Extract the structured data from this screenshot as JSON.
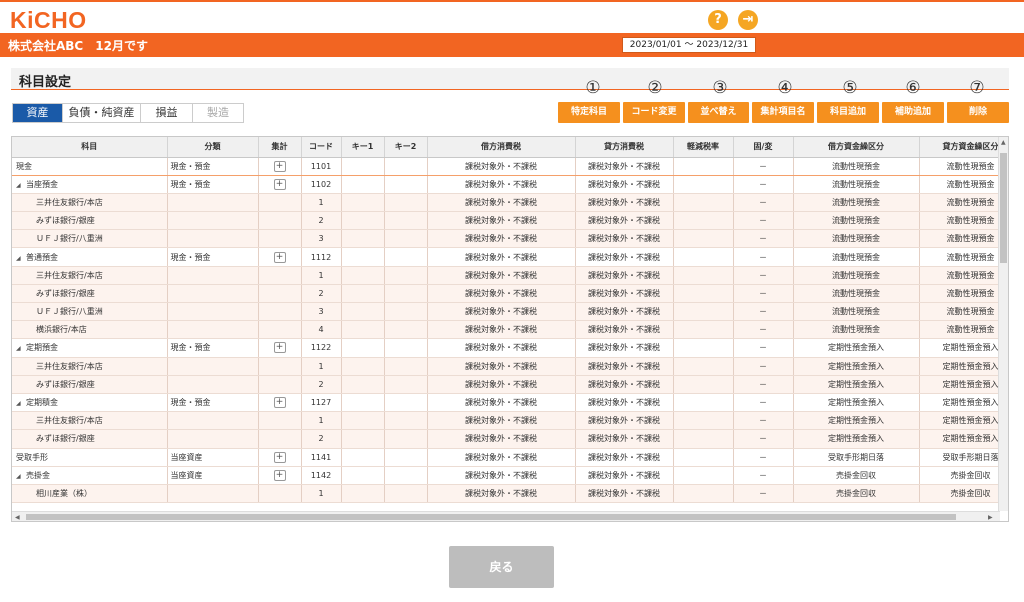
{
  "app": {
    "logo": "KiCHO",
    "company_label": "株式会社ABC　12月です",
    "period": "2023/01/01 ～ 2023/12/31",
    "help_icon": "question-icon",
    "logout_icon": "logout-icon",
    "accent_color": "#f26522"
  },
  "panel": {
    "title": "科目設定"
  },
  "tabs": [
    {
      "label": "資産",
      "active": true
    },
    {
      "label": "負債・純資産",
      "active": false
    },
    {
      "label": "損益",
      "active": false
    },
    {
      "label": "製造",
      "active": false,
      "disabled": true
    }
  ],
  "actions": [
    {
      "num": "①",
      "label": "特定科目"
    },
    {
      "num": "②",
      "label": "コード変更"
    },
    {
      "num": "③",
      "label": "並べ替え"
    },
    {
      "num": "④",
      "label": "集計項目名"
    },
    {
      "num": "⑤",
      "label": "科目追加"
    },
    {
      "num": "⑥",
      "label": "補助追加"
    },
    {
      "num": "⑦",
      "label": "削除"
    }
  ],
  "table": {
    "headers": [
      "科目",
      "分類",
      "集計",
      "コード",
      "キー1",
      "キー2",
      "借方消費税",
      "貸方消費税",
      "軽減税率",
      "固/変",
      "借方資金繰区分",
      "貸方資金繰区分"
    ],
    "rows": [
      {
        "type": "main",
        "expand": false,
        "name": "現金",
        "category": "現金・預金",
        "agg": true,
        "code": "1101",
        "debit_tax": "課税対象外・不課税",
        "credit_tax": "課税対象外・不課税",
        "fixvar": "－",
        "debit_fund": "流動性現預金",
        "credit_fund": "流動性現預金"
      },
      {
        "type": "main",
        "expand": true,
        "name": "当座預金",
        "category": "現金・預金",
        "agg": true,
        "code": "1102",
        "debit_tax": "課税対象外・不課税",
        "credit_tax": "課税対象外・不課税",
        "fixvar": "－",
        "debit_fund": "流動性現預金",
        "credit_fund": "流動性現預金"
      },
      {
        "type": "sub",
        "name": "三井住友銀行/本店",
        "code": "1",
        "debit_tax": "課税対象外・不課税",
        "credit_tax": "課税対象外・不課税",
        "fixvar": "－",
        "debit_fund": "流動性現預金",
        "credit_fund": "流動性現預金"
      },
      {
        "type": "sub",
        "name": "みずほ銀行/銀座",
        "code": "2",
        "debit_tax": "課税対象外・不課税",
        "credit_tax": "課税対象外・不課税",
        "fixvar": "－",
        "debit_fund": "流動性現預金",
        "credit_fund": "流動性現預金"
      },
      {
        "type": "sub",
        "name": "ＵＦＪ銀行/八重洲",
        "code": "3",
        "debit_tax": "課税対象外・不課税",
        "credit_tax": "課税対象外・不課税",
        "fixvar": "－",
        "debit_fund": "流動性現預金",
        "credit_fund": "流動性現預金"
      },
      {
        "type": "main",
        "expand": true,
        "name": "普通預金",
        "category": "現金・預金",
        "agg": true,
        "code": "1112",
        "debit_tax": "課税対象外・不課税",
        "credit_tax": "課税対象外・不課税",
        "fixvar": "－",
        "debit_fund": "流動性現預金",
        "credit_fund": "流動性現預金"
      },
      {
        "type": "sub",
        "name": "三井住友銀行/本店",
        "code": "1",
        "debit_tax": "課税対象外・不課税",
        "credit_tax": "課税対象外・不課税",
        "fixvar": "－",
        "debit_fund": "流動性現預金",
        "credit_fund": "流動性現預金"
      },
      {
        "type": "sub",
        "name": "みずほ銀行/銀座",
        "code": "2",
        "debit_tax": "課税対象外・不課税",
        "credit_tax": "課税対象外・不課税",
        "fixvar": "－",
        "debit_fund": "流動性現預金",
        "credit_fund": "流動性現預金"
      },
      {
        "type": "sub",
        "name": "ＵＦＪ銀行/八重洲",
        "code": "3",
        "debit_tax": "課税対象外・不課税",
        "credit_tax": "課税対象外・不課税",
        "fixvar": "－",
        "debit_fund": "流動性現預金",
        "credit_fund": "流動性現預金"
      },
      {
        "type": "sub",
        "name": "横浜銀行/本店",
        "code": "4",
        "debit_tax": "課税対象外・不課税",
        "credit_tax": "課税対象外・不課税",
        "fixvar": "－",
        "debit_fund": "流動性現預金",
        "credit_fund": "流動性現預金"
      },
      {
        "type": "main",
        "expand": true,
        "name": "定期預金",
        "category": "現金・預金",
        "agg": true,
        "code": "1122",
        "debit_tax": "課税対象外・不課税",
        "credit_tax": "課税対象外・不課税",
        "fixvar": "－",
        "debit_fund": "定期性預金預入",
        "credit_fund": "定期性預金預入"
      },
      {
        "type": "sub",
        "name": "三井住友銀行/本店",
        "code": "1",
        "debit_tax": "課税対象外・不課税",
        "credit_tax": "課税対象外・不課税",
        "fixvar": "－",
        "debit_fund": "定期性預金預入",
        "credit_fund": "定期性預金預入"
      },
      {
        "type": "sub",
        "name": "みずほ銀行/銀座",
        "code": "2",
        "debit_tax": "課税対象外・不課税",
        "credit_tax": "課税対象外・不課税",
        "fixvar": "－",
        "debit_fund": "定期性預金預入",
        "credit_fund": "定期性預金預入"
      },
      {
        "type": "main",
        "expand": true,
        "name": "定期積金",
        "category": "現金・預金",
        "agg": true,
        "code": "1127",
        "debit_tax": "課税対象外・不課税",
        "credit_tax": "課税対象外・不課税",
        "fixvar": "－",
        "debit_fund": "定期性預金預入",
        "credit_fund": "定期性預金預入"
      },
      {
        "type": "sub",
        "name": "三井住友銀行/本店",
        "code": "1",
        "debit_tax": "課税対象外・不課税",
        "credit_tax": "課税対象外・不課税",
        "fixvar": "－",
        "debit_fund": "定期性預金預入",
        "credit_fund": "定期性預金預入"
      },
      {
        "type": "sub",
        "name": "みずほ銀行/銀座",
        "code": "2",
        "debit_tax": "課税対象外・不課税",
        "credit_tax": "課税対象外・不課税",
        "fixvar": "－",
        "debit_fund": "定期性預金預入",
        "credit_fund": "定期性預金預入"
      },
      {
        "type": "main",
        "expand": false,
        "name": "受取手形",
        "category": "当座資産",
        "agg": true,
        "code": "1141",
        "debit_tax": "課税対象外・不課税",
        "credit_tax": "課税対象外・不課税",
        "fixvar": "－",
        "debit_fund": "受取手形期日落",
        "credit_fund": "受取手形期日落"
      },
      {
        "type": "main",
        "expand": true,
        "name": "売掛金",
        "category": "当座資産",
        "agg": true,
        "code": "1142",
        "debit_tax": "課税対象外・不課税",
        "credit_tax": "課税対象外・不課税",
        "fixvar": "－",
        "debit_fund": "売掛金回収",
        "credit_fund": "売掛金回収"
      },
      {
        "type": "sub",
        "name": "相川産業（株）",
        "code": "1",
        "debit_tax": "課税対象外・不課税",
        "credit_tax": "課税対象外・不課税",
        "fixvar": "－",
        "debit_fund": "売掛金回収",
        "credit_fund": "売掛金回収"
      }
    ]
  },
  "footer": {
    "back_label": "戻る"
  }
}
